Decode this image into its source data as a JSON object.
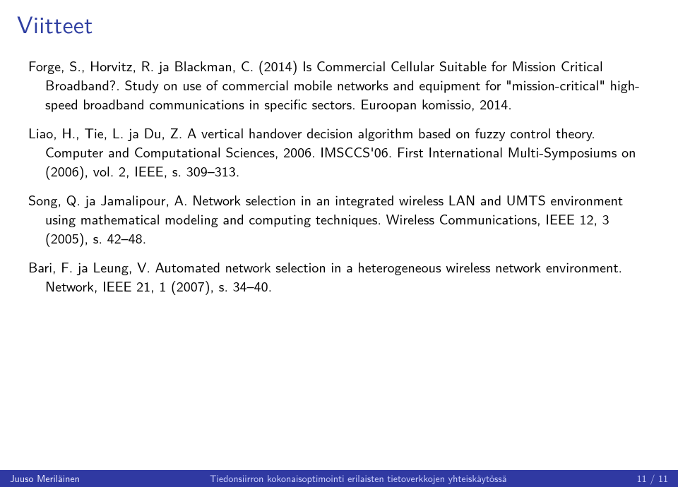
{
  "slide": {
    "title": "Viitteet",
    "references": [
      "Forge, S., Horvitz, R. ja Blackman, C. (2014) Is Commercial Cellular Suitable for Mission Critical Broadband?. Study on use of commercial mobile networks and equipment for \"mission-critical\" high-speed broadband communications in specific sectors. Euroopan komissio, 2014.",
      "Liao, H., Tie, L. ja Du, Z. A vertical handover decision algorithm based on fuzzy control theory. Computer and Computational Sciences, 2006. IMSCCS'06. First International Multi-Symposiums on (2006), vol. 2, IEEE, s. 309–313.",
      "Song, Q. ja Jamalipour, A. Network selection in an integrated wireless LAN and UMTS environment using mathematical modeling and computing techniques. Wireless Communications, IEEE 12, 3 (2005), s. 42–48.",
      "Bari, F. ja Leung, V. Automated network selection in a heterogeneous wireless network environment. Network, IEEE 21, 1 (2007), s. 34–40."
    ]
  },
  "footer": {
    "author": "Juuso Meriläinen",
    "talk_title": "Tiedonsiirron kokonaisoptimointi erilaisten tietoverkkojen yhteiskäytössä",
    "page": "11 / 11"
  },
  "colors": {
    "title": "#2f3fa2",
    "footer_bg": "#3039a2"
  }
}
